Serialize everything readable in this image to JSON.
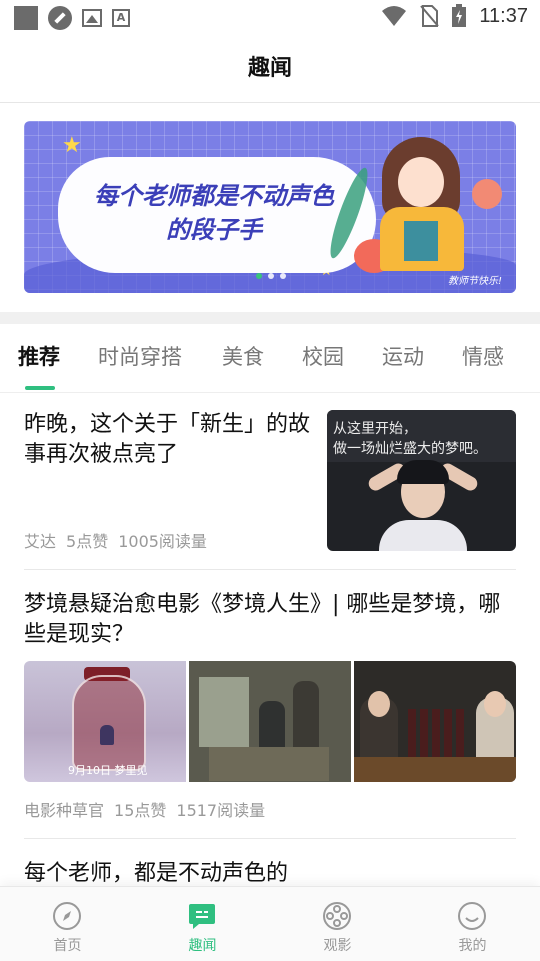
{
  "status_bar": {
    "time": "11:37"
  },
  "header": {
    "title": "趣闻"
  },
  "banner": {
    "headline_line1": "每个老师都是不动声色",
    "headline_line2": "的段子手",
    "caption": "教师节快乐!",
    "dots": 3,
    "active_dot": 0
  },
  "tabs": [
    "推荐",
    "时尚穿搭",
    "美食",
    "校园",
    "运动",
    "情感"
  ],
  "active_tab": 0,
  "articles": [
    {
      "title": "昨晚，这个关于「新生」的故事再次被点亮了",
      "author": "艾达",
      "likes": "5点赞",
      "reads": "1005阅读量",
      "thumb_text1": "从这里开始，",
      "thumb_text2": "做一场灿烂盛大的梦吧。"
    },
    {
      "title": "梦境悬疑治愈电影《梦境人生》| 哪些是梦境，哪些是现实？",
      "author": "电影种草官",
      "likes": "15点赞",
      "reads": "1517阅读量",
      "thumb1_caption": "9月10日 梦里见"
    },
    {
      "title": "每个老师，都是不动声色的"
    }
  ],
  "bottom_nav": [
    {
      "label": "首页",
      "icon": "compass-icon"
    },
    {
      "label": "趣闻",
      "icon": "chat-icon"
    },
    {
      "label": "观影",
      "icon": "film-reel-icon"
    },
    {
      "label": "我的",
      "icon": "profile-icon"
    }
  ],
  "active_nav": 1,
  "colors": {
    "accent": "#2fbf80",
    "banner": "#7b7fe6"
  }
}
